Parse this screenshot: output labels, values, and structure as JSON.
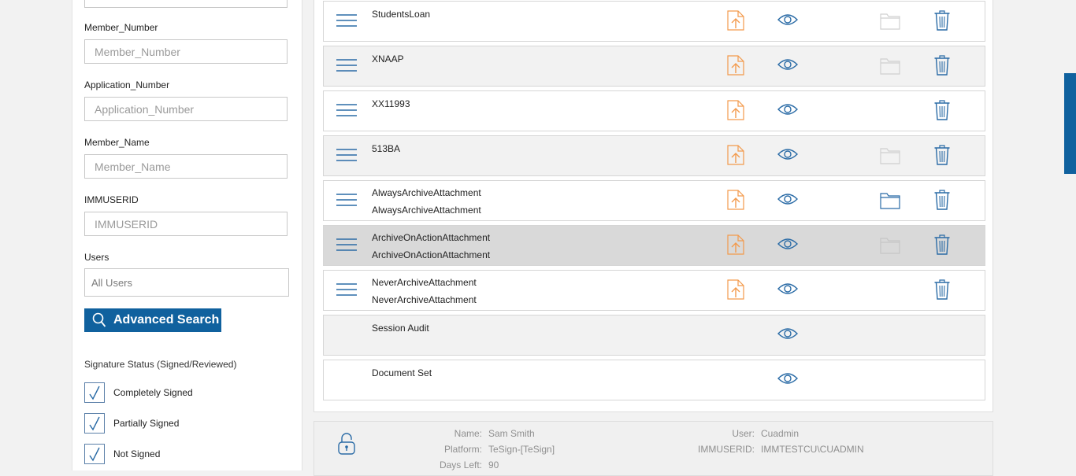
{
  "filters": {
    "member_number": {
      "label": "Member_Number",
      "placeholder": "Member_Number"
    },
    "application_number": {
      "label": "Application_Number",
      "placeholder": "Application_Number"
    },
    "member_name": {
      "label": "Member_Name",
      "placeholder": "Member_Name"
    },
    "immuserid": {
      "label": "IMMUSERID",
      "placeholder": "IMMUSERID"
    },
    "users": {
      "label": "Users",
      "value": "All Users"
    },
    "advanced_search_label": "Advanced Search",
    "signature_status": {
      "title": "Signature Status (Signed/Reviewed)",
      "options": [
        {
          "label": "Completely Signed",
          "checked": true
        },
        {
          "label": "Partially Signed",
          "checked": true
        },
        {
          "label": "Not Signed",
          "checked": true
        }
      ]
    }
  },
  "documents": [
    {
      "line1": "StudentsLoan",
      "line2": "",
      "has_upload": true,
      "has_folder": true,
      "folder_active": false,
      "has_trash": true,
      "shade": "white"
    },
    {
      "line1": "XNAAP",
      "line2": "",
      "has_upload": true,
      "has_folder": true,
      "folder_active": false,
      "has_trash": true,
      "shade": "grey"
    },
    {
      "line1": "XX11993",
      "line2": "",
      "has_upload": true,
      "has_folder": false,
      "folder_active": false,
      "has_trash": true,
      "shade": "white"
    },
    {
      "line1": "513BA",
      "line2": "",
      "has_upload": true,
      "has_folder": true,
      "folder_active": false,
      "has_trash": true,
      "shade": "grey"
    },
    {
      "line1": "AlwaysArchiveAttachment",
      "line2": "AlwaysArchiveAttachment",
      "has_upload": true,
      "has_folder": true,
      "folder_active": true,
      "has_trash": true,
      "shade": "white"
    },
    {
      "line1": "ArchiveOnActionAttachment",
      "line2": "ArchiveOnActionAttachment",
      "has_upload": true,
      "has_folder": true,
      "folder_active": false,
      "has_trash": true,
      "shade": "selected"
    },
    {
      "line1": "NeverArchiveAttachment",
      "line2": "NeverArchiveAttachment",
      "has_upload": true,
      "has_folder": false,
      "folder_active": false,
      "has_trash": true,
      "shade": "white"
    },
    {
      "line1": "Session Audit",
      "line2": "",
      "has_upload": false,
      "has_folder": false,
      "folder_active": false,
      "has_trash": false,
      "shade": "grey"
    },
    {
      "line1": "Document Set",
      "line2": "",
      "has_upload": false,
      "has_folder": false,
      "folder_active": false,
      "has_trash": false,
      "shade": "white"
    }
  ],
  "footer": {
    "name_label": "Name:",
    "name_value": "Sam Smith",
    "platform_label": "Platform:",
    "platform_value": "TeSign-[TeSign]",
    "days_left_label": "Days Left:",
    "days_left_value": "90",
    "user_label": "User:",
    "user_value": "Cuadmin",
    "immuserid_label": "IMMUSERID:",
    "immuserid_value": "IMMTESTCU\\CUADMIN"
  },
  "colors": {
    "accent": "#10619e",
    "icon_blue": "#2a6ba6",
    "upload_orange": "#f39a4c",
    "folder_inactive": "#d0d0d0"
  },
  "icons": {
    "row_menu": "hamburger-menu-icon",
    "upload": "file-upload-icon",
    "view": "eye-icon",
    "archive": "folder-icon",
    "delete": "trash-icon",
    "search": "search-icon",
    "lock": "lock-icon",
    "check": "checkmark-icon"
  }
}
